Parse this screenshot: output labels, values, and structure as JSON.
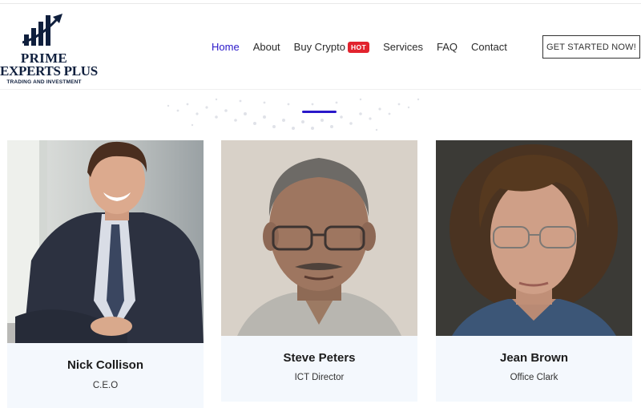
{
  "brand": {
    "line1": "PRIME",
    "line2": "EXPERTS PLUS",
    "tagline": "TRADING AND INVESTMENT",
    "color": "#0f1f3d"
  },
  "nav": {
    "items": [
      {
        "label": "Home",
        "active": true
      },
      {
        "label": "About"
      },
      {
        "label": "Buy Crypto",
        "badge": "HOT"
      },
      {
        "label": "Services"
      },
      {
        "label": "FAQ"
      },
      {
        "label": "Contact"
      }
    ],
    "active_color": "#2a18c9",
    "badge_color": "#e2232e"
  },
  "cta": {
    "label": "GET STARTED NOW!"
  },
  "team": [
    {
      "name": "Nick Collison",
      "role": "C.E.O",
      "photo_icon": "smiling-man-in-suit-photo"
    },
    {
      "name": "Steve Peters",
      "role": "ICT Director",
      "photo_icon": "man-with-glasses-photo"
    },
    {
      "name": "Jean Brown",
      "role": "Office Clark",
      "photo_icon": "woman-with-glasses-photo"
    }
  ]
}
